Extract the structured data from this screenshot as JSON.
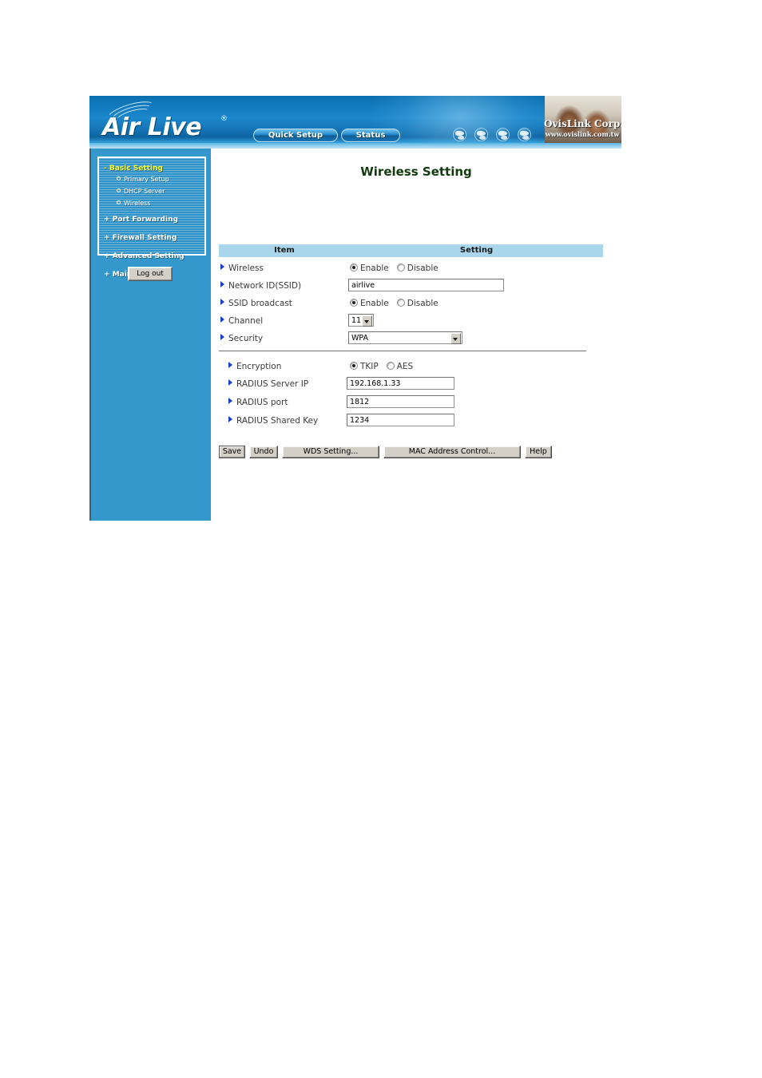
{
  "banner": {
    "logo_text": "Air Live",
    "logo_registered": "®",
    "nav": [
      {
        "label": "Quick Setup",
        "name": "quick-setup"
      },
      {
        "label": "Status",
        "name": "status"
      }
    ],
    "corp_name": "OvisLink Corp.",
    "corp_url": "www.ovislink.com.tw",
    "globe_icons": [
      "globe-icon-1",
      "globe-icon-2",
      "globe-icon-3",
      "globe-icon-4"
    ]
  },
  "sidebar": {
    "groups": [
      {
        "label": "- Basic Setting",
        "state": "expanded",
        "items": [
          {
            "label": "Primary Setup"
          },
          {
            "label": "DHCP Server"
          },
          {
            "label": "Wireless"
          }
        ]
      },
      {
        "label": "+ Port Forwarding",
        "state": "collapsed",
        "items": []
      },
      {
        "label": "+ Firewall Setting",
        "state": "collapsed",
        "items": []
      },
      {
        "label": "+ Advanced Setting",
        "state": "collapsed",
        "items": []
      },
      {
        "label": "+ Maintenance",
        "state": "collapsed",
        "items": []
      }
    ],
    "logout_label": "Log out",
    "accent_active": "#ffff2a",
    "panel_color": "#3498cd"
  },
  "main": {
    "title": "Wireless Setting",
    "table": {
      "header_item": "Item",
      "header_setting": "Setting",
      "header_bg": "#a9d6ea"
    },
    "rows": {
      "wireless": {
        "label": "Wireless",
        "option_enable": "Enable",
        "option_disable": "Disable",
        "selected": "Enable"
      },
      "ssid": {
        "label": "Network ID(SSID)",
        "value": "airlive",
        "placeholder": ""
      },
      "ssid_broadcast": {
        "label": "SSID broadcast",
        "option_enable": "Enable",
        "option_disable": "Disable",
        "selected": "Enable"
      },
      "channel": {
        "label": "Channel",
        "value": "11",
        "options": [
          "11"
        ]
      },
      "security": {
        "label": "Security",
        "value": "WPA",
        "options": [
          "WPA"
        ]
      },
      "encryption": {
        "label": "Encryption",
        "option_tkip": "TKIP",
        "option_aes": "AES",
        "selected": "TKIP"
      },
      "radius_server_ip": {
        "label": "RADIUS Server IP",
        "value": "192.168.1.33"
      },
      "radius_port": {
        "label": "RADIUS port",
        "value": "1812"
      },
      "radius_shared_key": {
        "label": "RADIUS Shared Key",
        "value": "1234"
      }
    },
    "buttons": [
      {
        "label": "Save",
        "name": "save-button"
      },
      {
        "label": "Undo",
        "name": "undo-button"
      },
      {
        "label": "WDS Setting...",
        "name": "wds-setting-button"
      },
      {
        "label": "MAC Address Control...",
        "name": "mac-address-control-button"
      },
      {
        "label": "Help",
        "name": "help-button"
      }
    ]
  }
}
